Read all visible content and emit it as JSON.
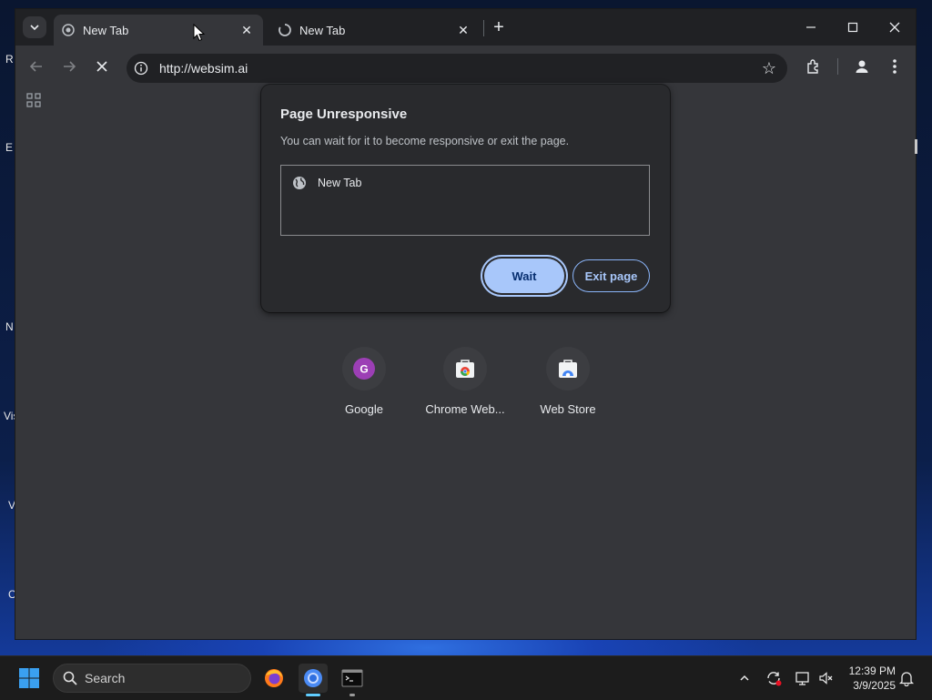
{
  "browser": {
    "tabs": [
      {
        "title": "New Tab",
        "active": true,
        "loading": false
      },
      {
        "title": "New Tab",
        "active": false,
        "loading": true
      }
    ],
    "address_bar": {
      "url": "http://websim.ai"
    },
    "window_controls": [
      "minimize-icon",
      "maximize-icon",
      "close-icon"
    ]
  },
  "dialog": {
    "title": "Page Unresponsive",
    "message": "You can wait for it to become responsive or exit the page.",
    "pages": [
      {
        "title": "New Tab",
        "icon": "globe-icon"
      }
    ],
    "wait_label": "Wait",
    "exit_label": "Exit page"
  },
  "shortcuts": [
    {
      "label": "Google",
      "icon": "G",
      "icon_color": "#9c3fb5"
    },
    {
      "label": "Chrome Web...",
      "icon": "chrome-web-store-icon"
    },
    {
      "label": "Web Store",
      "icon": "web-store-icon"
    }
  ],
  "desktop": {
    "icon_letters": [
      "R",
      "E",
      "N",
      "Vis",
      "V",
      "C"
    ]
  },
  "taskbar": {
    "search_placeholder": "Search",
    "apps": [
      "firefox-icon",
      "chrome-icon",
      "terminal-icon"
    ],
    "clock": {
      "time": "12:39 PM",
      "date": "3/9/2025"
    }
  },
  "colors": {
    "accent": "#a8c7fa",
    "dialog_bg": "#292a2d",
    "browser_bg": "#35363a",
    "tabstrip_bg": "#202124"
  }
}
